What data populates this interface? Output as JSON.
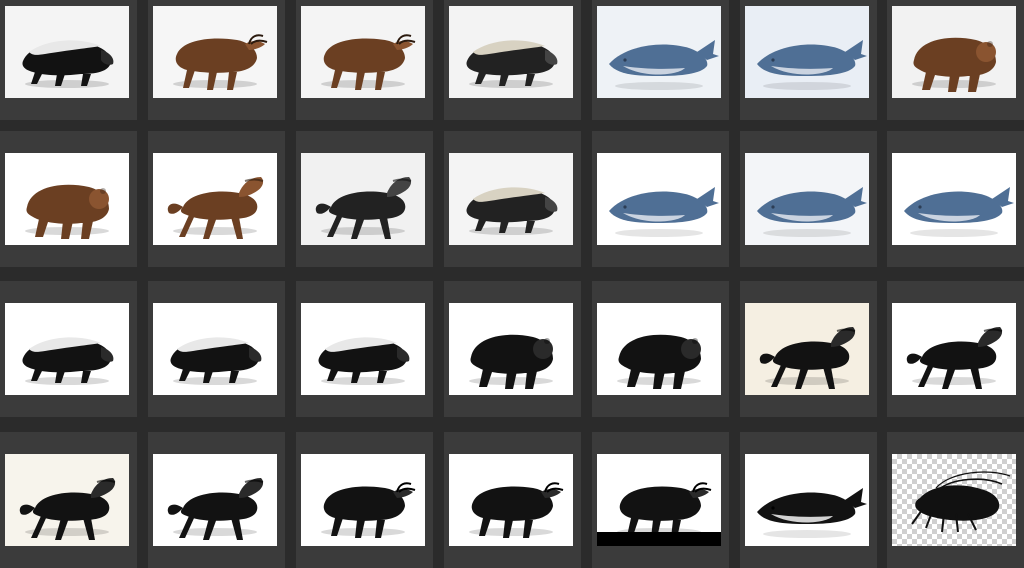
{
  "gallery": {
    "rows": [
      [
        {
          "subject": "honey-badger",
          "style": "ink",
          "bg": "#f4f4f4"
        },
        {
          "subject": "bull",
          "style": "brown",
          "bg": "#f6f6f6"
        },
        {
          "subject": "bull",
          "style": "brown",
          "bg": "#f4f4f4"
        },
        {
          "subject": "honey-badger",
          "style": "dark",
          "bg": "#f3f3f3"
        },
        {
          "subject": "whale",
          "style": "blue",
          "bg": "#eef2f6"
        },
        {
          "subject": "whale",
          "style": "blue",
          "bg": "#e9eef5"
        },
        {
          "subject": "bear",
          "style": "brown",
          "bg": "#f2f2f2"
        }
      ],
      [
        {
          "subject": "bear",
          "style": "brown",
          "bg": "#ffffff"
        },
        {
          "subject": "horse",
          "style": "brown",
          "bg": "#ffffff"
        },
        {
          "subject": "horse",
          "style": "dark",
          "bg": "#f1f1f1"
        },
        {
          "subject": "honey-badger",
          "style": "dark",
          "bg": "#f4f4f4"
        },
        {
          "subject": "whale",
          "style": "blue",
          "bg": "#ffffff"
        },
        {
          "subject": "whale",
          "style": "blue",
          "bg": "#f3f5f8"
        },
        {
          "subject": "whale",
          "style": "blue",
          "bg": "#ffffff"
        }
      ],
      [
        {
          "subject": "honey-badger",
          "style": "ink",
          "bg": "#ffffff"
        },
        {
          "subject": "honey-badger",
          "style": "ink",
          "bg": "#ffffff"
        },
        {
          "subject": "honey-badger",
          "style": "ink",
          "bg": "#ffffff"
        },
        {
          "subject": "bear",
          "style": "ink",
          "bg": "#ffffff"
        },
        {
          "subject": "bear",
          "style": "ink",
          "bg": "#ffffff"
        },
        {
          "subject": "horse",
          "style": "ink",
          "bg": "#f5efe2"
        },
        {
          "subject": "horse",
          "style": "ink",
          "bg": "#ffffff"
        }
      ],
      [
        {
          "subject": "horse",
          "style": "ink",
          "bg": "#f7f4ec"
        },
        {
          "subject": "horse",
          "style": "ink",
          "bg": "#ffffff"
        },
        {
          "subject": "bull",
          "style": "ink",
          "bg": "#ffffff"
        },
        {
          "subject": "bull",
          "style": "ink",
          "bg": "#ffffff"
        },
        {
          "subject": "bull",
          "style": "ink-bar",
          "bg": "#ffffff"
        },
        {
          "subject": "whale",
          "style": "ink",
          "bg": "#ffffff"
        },
        {
          "subject": "shrimp",
          "style": "ink",
          "bg": "checker"
        }
      ]
    ]
  },
  "colors": {
    "window_bg": "#2b2b2b",
    "cell_bg": "#3b3b3b"
  }
}
